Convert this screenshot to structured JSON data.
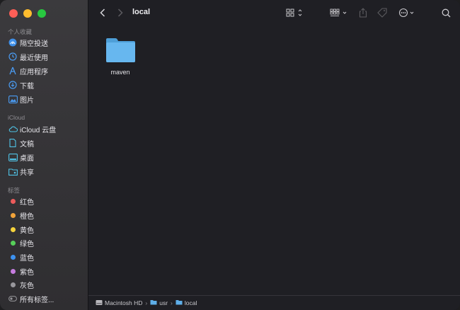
{
  "window": {
    "title": "local"
  },
  "sidebar": {
    "favorites_title": "个人收藏",
    "favorites": [
      {
        "label": "隔空投送",
        "icon": "airdrop-icon"
      },
      {
        "label": "最近使用",
        "icon": "clock-icon"
      },
      {
        "label": "应用程序",
        "icon": "applications-icon"
      },
      {
        "label": "下载",
        "icon": "download-icon"
      },
      {
        "label": "图片",
        "icon": "photo-icon"
      }
    ],
    "icloud_title": "iCloud",
    "icloud": [
      {
        "label": "iCloud 云盘",
        "icon": "cloud-icon"
      },
      {
        "label": "文稿",
        "icon": "document-icon"
      },
      {
        "label": "桌面",
        "icon": "desktop-icon"
      },
      {
        "label": "共享",
        "icon": "shared-folder-icon"
      }
    ],
    "tags_title": "标签",
    "tags": [
      {
        "label": "红色",
        "color": "#ec5b5b"
      },
      {
        "label": "橙色",
        "color": "#f1a33a"
      },
      {
        "label": "黄色",
        "color": "#f5d33c"
      },
      {
        "label": "绿色",
        "color": "#57d05a"
      },
      {
        "label": "蓝色",
        "color": "#3d92f0"
      },
      {
        "label": "紫色",
        "color": "#c67ddf"
      },
      {
        "label": "灰色",
        "color": "#98979c"
      }
    ],
    "all_tags_label": "所有标签..."
  },
  "toolbar": {
    "title": "local",
    "icons": [
      "back-icon",
      "forward-icon",
      "view-grid-icon",
      "group-icon",
      "share-icon",
      "tag-icon",
      "more-icon",
      "search-icon"
    ]
  },
  "files": [
    {
      "name": "maven",
      "icon": "folder-icon"
    }
  ],
  "pathbar": {
    "items": [
      {
        "label": "Macintosh HD",
        "icon": "disk-icon"
      },
      {
        "label": "usr",
        "icon": "folder-icon"
      },
      {
        "label": "local",
        "icon": "folder-icon"
      }
    ],
    "separator": "›"
  },
  "colors": {
    "accent": "#3d92f0",
    "folder_blue": "#63b5ec"
  }
}
